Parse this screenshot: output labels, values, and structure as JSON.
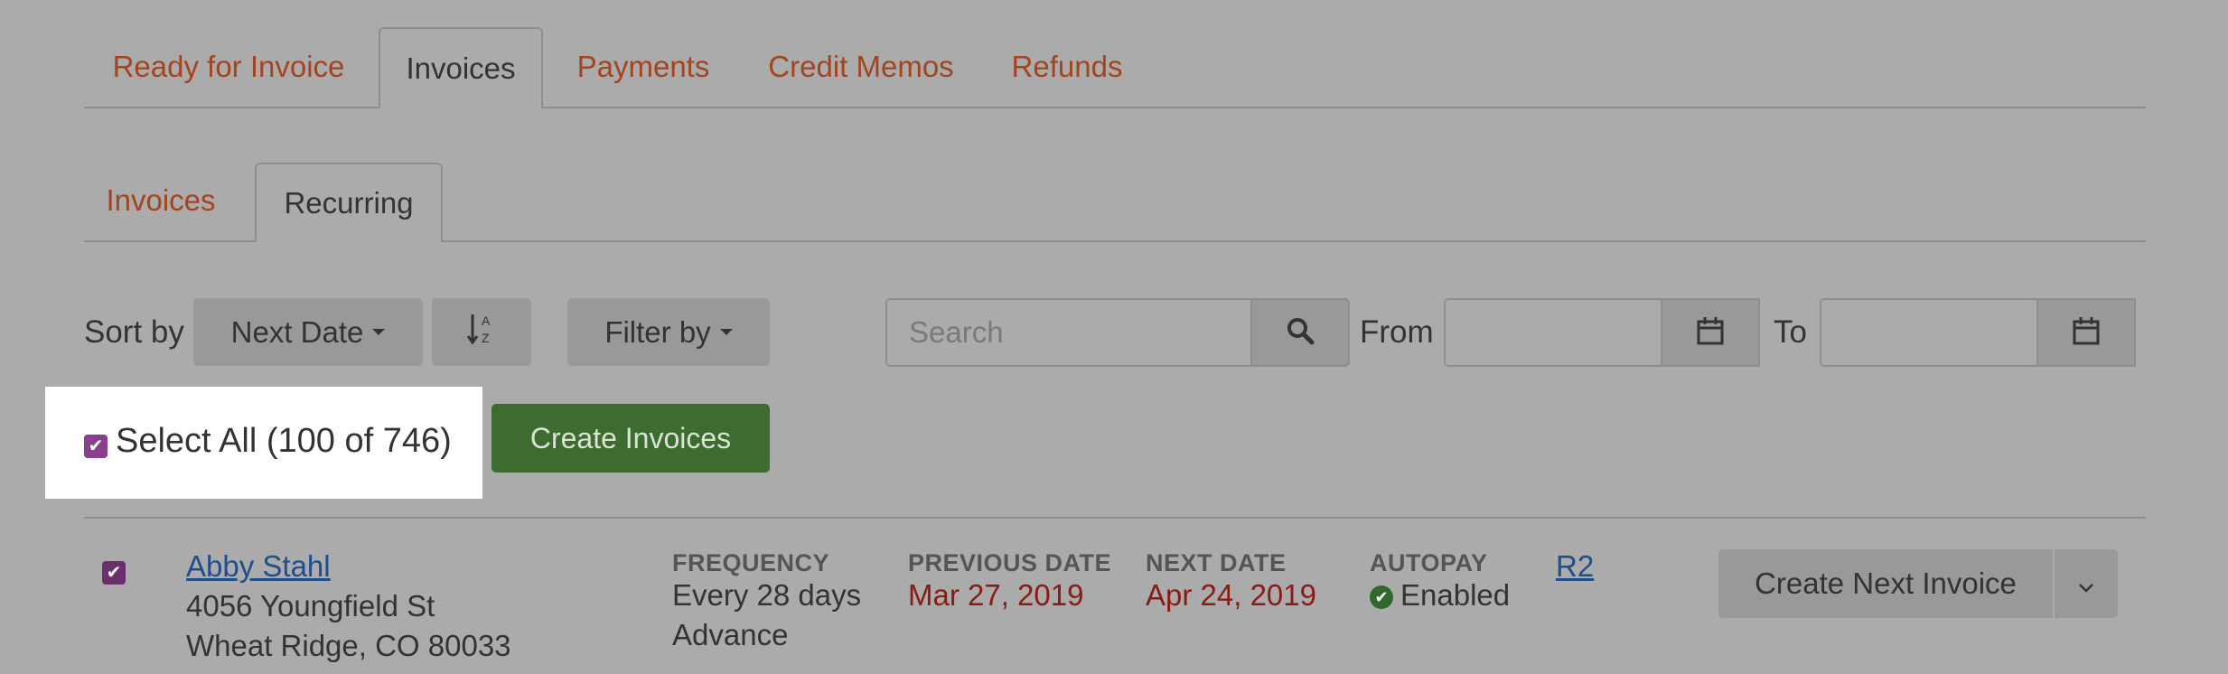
{
  "main_tabs": [
    {
      "label": "Ready for Invoice",
      "active": false
    },
    {
      "label": "Invoices",
      "active": true
    },
    {
      "label": "Payments",
      "active": false
    },
    {
      "label": "Credit Memos",
      "active": false
    },
    {
      "label": "Refunds",
      "active": false
    }
  ],
  "sub_tabs": [
    {
      "label": "Invoices",
      "active": false
    },
    {
      "label": "Recurring",
      "active": true
    }
  ],
  "toolbar": {
    "sort_by_label": "Sort by",
    "sort_value": "Next Date",
    "sort_direction_icon": "sort-alpha-asc-icon",
    "filter_label": "Filter by",
    "search_placeholder": "Search",
    "from_label": "From",
    "from_value": "",
    "to_label": "To",
    "to_value": ""
  },
  "select_all": {
    "label": "Select All (100 of 746)",
    "checked": true
  },
  "create_invoices_label": "Create Invoices",
  "rows": [
    {
      "checked": true,
      "customer_name": "Abby Stahl",
      "address_line1": "4056 Youngfield St",
      "address_line2": "Wheat Ridge, CO 80033",
      "frequency_label": "FREQUENCY",
      "frequency_value": "Every 28 days",
      "frequency_mode": "Advance",
      "previous_date_label": "PREVIOUS DATE",
      "previous_date": "Mar 27, 2019",
      "next_date_label": "NEXT DATE",
      "next_date": "Apr 24, 2019",
      "autopay_label": "AUTOPAY",
      "autopay_value": "Enabled",
      "reference": "R2",
      "action_label": "Create Next Invoice"
    }
  ],
  "colors": {
    "background": "#ababab",
    "link_orange": "#a3441f",
    "link_blue": "#1f4e8c",
    "date_red": "#8a1b12",
    "checkbox_purple": "#8a3f8e",
    "button_green": "#3e6b30"
  }
}
